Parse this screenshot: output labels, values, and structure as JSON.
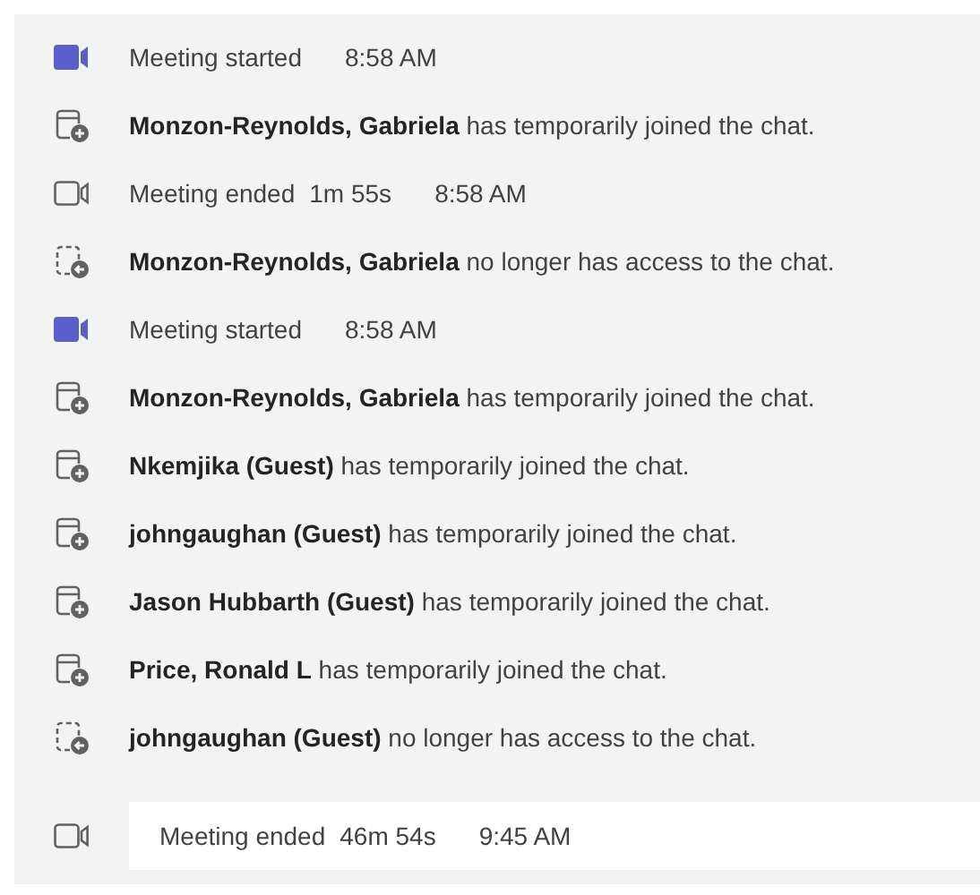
{
  "events": [
    {
      "kind": "started",
      "highlighted": false,
      "label": "Meeting started",
      "time": "8:58 AM"
    },
    {
      "kind": "joined",
      "highlighted": false,
      "text": "**Monzon-Reynolds, Gabriela** has temporarily joined the chat."
    },
    {
      "kind": "ended",
      "highlighted": false,
      "label": "Meeting ended",
      "duration": "1m 55s",
      "time": "8:58 AM"
    },
    {
      "kind": "left",
      "highlighted": false,
      "text": "**Monzon-Reynolds, Gabriela** no longer has access to the chat."
    },
    {
      "kind": "started",
      "highlighted": false,
      "label": "Meeting started",
      "time": "8:58 AM"
    },
    {
      "kind": "joined",
      "highlighted": false,
      "text": "**Monzon-Reynolds, Gabriela** has temporarily joined the chat."
    },
    {
      "kind": "joined",
      "highlighted": false,
      "text": "**Nkemjika (Guest)** has temporarily joined the chat."
    },
    {
      "kind": "joined",
      "highlighted": false,
      "text": "**johngaughan (Guest)** has temporarily joined the chat."
    },
    {
      "kind": "joined",
      "highlighted": false,
      "text": "**Jason Hubbarth (Guest)** has temporarily joined the chat."
    },
    {
      "kind": "joined",
      "highlighted": false,
      "text": "**Price, Ronald L** has temporarily joined the chat."
    },
    {
      "kind": "left",
      "highlighted": false,
      "text": "**johngaughan (Guest)** no longer has access to the chat."
    },
    {
      "kind": "ended",
      "highlighted": true,
      "label": "Meeting ended",
      "duration": "46m 54s",
      "time": "9:45 AM"
    }
  ]
}
